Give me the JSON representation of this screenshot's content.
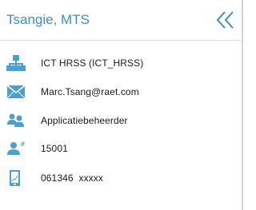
{
  "header": {
    "title": "Tsangie, MTS",
    "collapse_icon": "double-chevron-left-icon"
  },
  "colors": {
    "accent": "#3b8fc4",
    "icon": "#4aa0d4"
  },
  "details": [
    {
      "icon": "org-chart-icon",
      "value": "ICT HRSS (ICT_HRSS)"
    },
    {
      "icon": "envelope-icon",
      "value": "Marc.Tsang@raet.com"
    },
    {
      "icon": "people-icon",
      "value": "Applicatiebeheerder"
    },
    {
      "icon": "person-number-icon",
      "value": "15001"
    },
    {
      "icon": "mobile-phone-icon",
      "value": "061346  xxxxx"
    }
  ]
}
